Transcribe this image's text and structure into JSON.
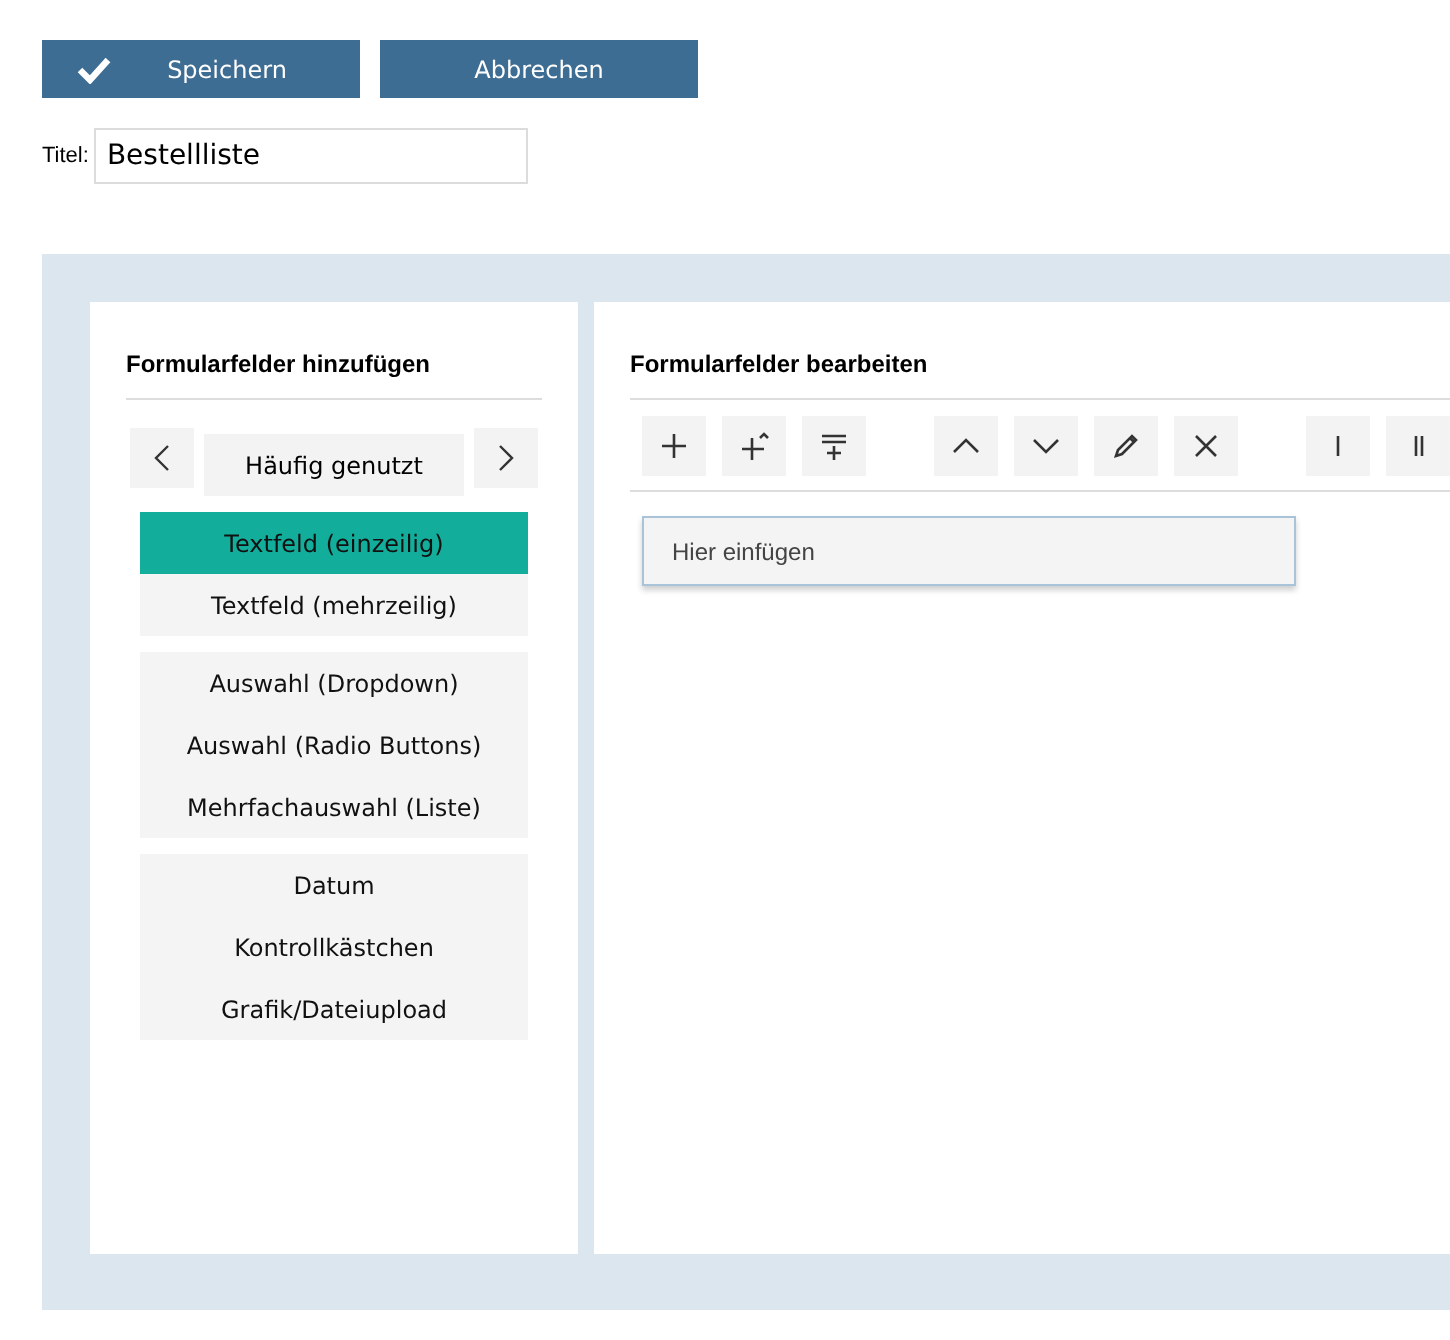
{
  "actions": [
    {
      "label": "Speichern",
      "kind": "save"
    },
    {
      "label": "Abbrechen",
      "kind": "cancel"
    }
  ],
  "title_field": {
    "label": "Titel:",
    "value": "Bestellliste"
  },
  "add_panel": {
    "heading": "Formularfelder hinzufügen",
    "category": "Häufig genutzt",
    "groups": [
      [
        {
          "label": "Textfeld (einzeilig)",
          "selected": true
        },
        {
          "label": "Textfeld (mehrzeilig)",
          "selected": false
        }
      ],
      [
        {
          "label": "Auswahl (Dropdown)",
          "selected": false
        },
        {
          "label": "Auswahl (Radio Buttons)",
          "selected": false
        },
        {
          "label": "Mehrfachauswahl (Liste)",
          "selected": false
        }
      ],
      [
        {
          "label": "Datum",
          "selected": false
        },
        {
          "label": "Kontrollkästchen",
          "selected": false
        },
        {
          "label": "Grafik/Dateiupload",
          "selected": false
        }
      ]
    ]
  },
  "edit_panel": {
    "heading": "Formularfelder bearbeiten",
    "tools": [
      {
        "kind": "add"
      },
      {
        "kind": "add-above"
      },
      {
        "kind": "add-below"
      },
      {
        "kind": "gap"
      },
      {
        "kind": "up"
      },
      {
        "kind": "down"
      },
      {
        "kind": "edit"
      },
      {
        "kind": "delete"
      },
      {
        "kind": "gap"
      },
      {
        "kind": "one-column"
      },
      {
        "kind": "two-column"
      }
    ],
    "drop_zone": "Hier einfügen"
  }
}
